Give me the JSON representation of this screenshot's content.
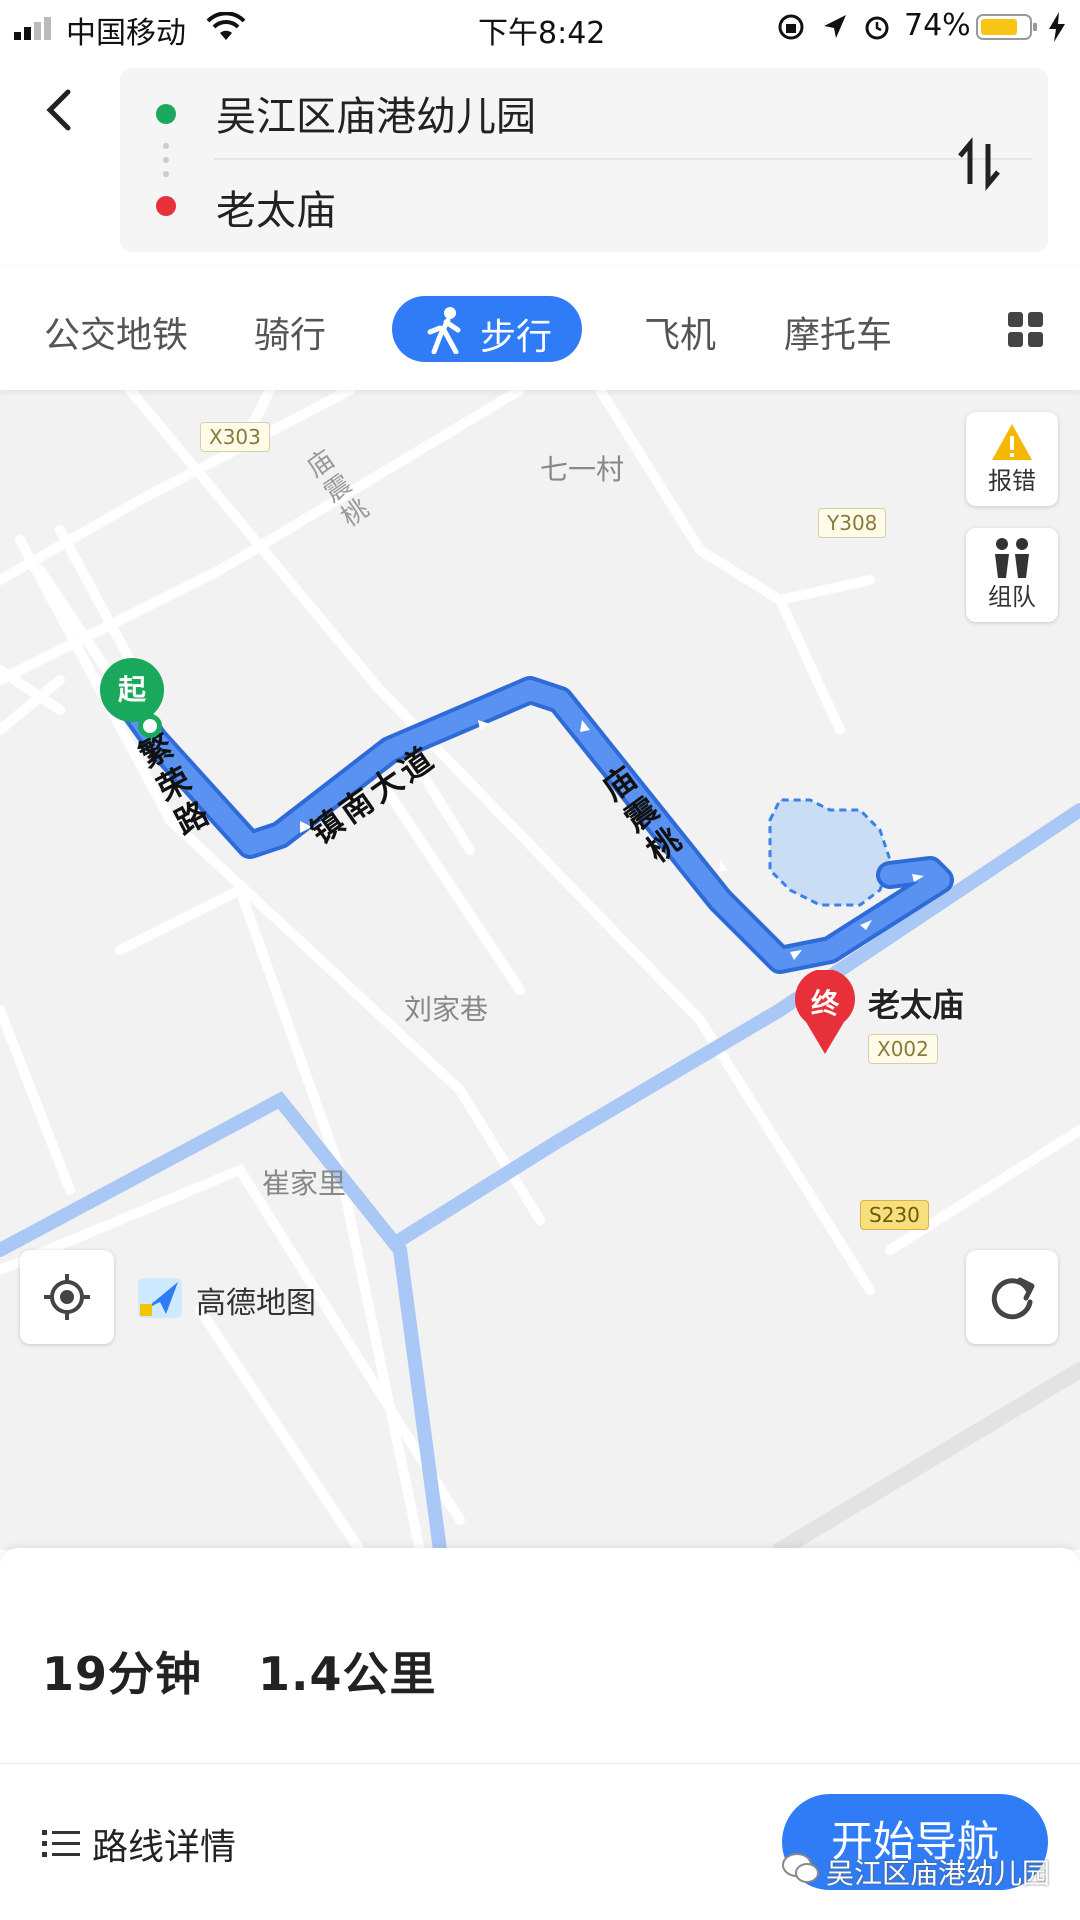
{
  "status_bar": {
    "carrier": "中国移动",
    "time": "下午8:42",
    "battery": "74%"
  },
  "header": {
    "origin": "吴江区庙港幼儿园",
    "destination": "老太庙"
  },
  "tabs": [
    {
      "label": "公交地铁"
    },
    {
      "label": "骑行"
    },
    {
      "label": "步行"
    },
    {
      "label": "飞机"
    },
    {
      "label": "摩托车"
    }
  ],
  "map": {
    "report_label": "报错",
    "team_label": "组队",
    "start_marker": "起",
    "end_marker": "终",
    "end_name": "老太庙",
    "roads": {
      "fanrong": "繁荣路",
      "zhennan": "镇南大道",
      "miaozhentao_route": "庙震桃",
      "miaozhentao_top": "庙震桃"
    },
    "places": {
      "qiyi": "七一村",
      "liujia": "刘家巷",
      "cuijia": "崔家里"
    },
    "road_tags": {
      "x303": "X303",
      "y308": "Y308",
      "x002": "X002",
      "s230": "S230"
    },
    "brand": "高德地图"
  },
  "panel": {
    "duration": "19分钟",
    "distance": "1.4公里",
    "details_label": "路线详情",
    "start_label": "开始导航",
    "watermark": "吴江区庙港幼儿园"
  },
  "colors": {
    "accent": "#2f7cf6",
    "route": "#4a86f0",
    "start_green": "#1aa85c",
    "end_red": "#e8303a"
  }
}
